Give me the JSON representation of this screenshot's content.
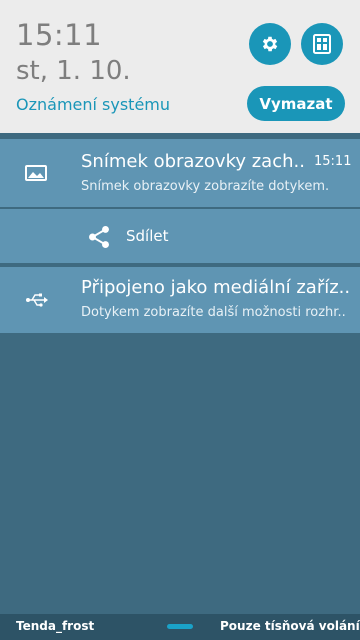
{
  "header": {
    "time": "15:11",
    "date": "st, 1. 10.",
    "label": "Oznámení systému",
    "clear_label": "Vymazat",
    "settings_icon": "gear-icon",
    "panel_icon": "quick-settings-icon"
  },
  "notifications": [
    {
      "icon": "image-icon",
      "title": "Snímek obrazovky zach..",
      "time": "15:11",
      "text": "Snímek obrazovky zobrazíte dotykem.",
      "action": {
        "icon": "share-icon",
        "label": "Sdílet"
      }
    },
    {
      "icon": "usb-icon",
      "title": "Připojeno jako mediální zaříz..",
      "text": "Dotykem zobrazíte další možnosti rozhr.."
    }
  ],
  "footer": {
    "carrier": "Tenda_frost",
    "emergency": "Pouze tísňová volání"
  },
  "colors": {
    "accent": "#1a96b8",
    "card": "#5f95b3",
    "background": "#3e6a80",
    "header": "#ececec"
  }
}
